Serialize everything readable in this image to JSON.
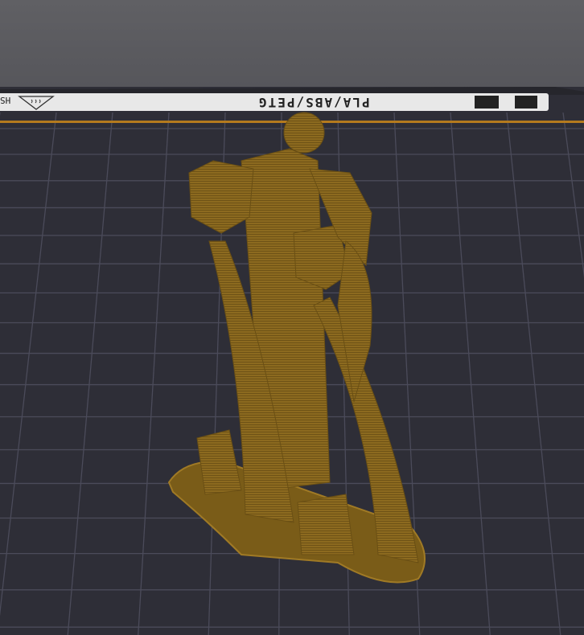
{
  "plate": {
    "label_text": "PLA/ABS/PETG",
    "side_text": "HS",
    "icons": [
      "heated-bed-icon",
      "bambu-logo-icon",
      "brand-logo-icon"
    ]
  },
  "colors": {
    "filament": "#8c6a1f",
    "plate": "#2e2e37",
    "grid": "#4b4b5a",
    "edge": "#b47a1e"
  }
}
